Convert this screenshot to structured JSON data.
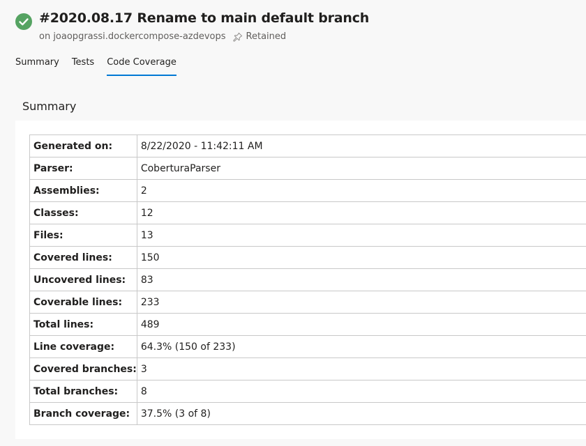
{
  "header": {
    "title": "#2020.08.17 Rename to main default branch",
    "subtitle": "on joaopgrassi.dockercompose-azdevops",
    "retained_label": "Retained",
    "status_icon": "check-circle-icon",
    "status_color": "#55a362"
  },
  "tabs": [
    {
      "label": "Summary"
    },
    {
      "label": "Tests"
    },
    {
      "label": "Code Coverage",
      "active": true
    }
  ],
  "accent_color": "#0078d4",
  "summary": {
    "section_title": "Summary",
    "rows": [
      {
        "key": "Generated on:",
        "value": "8/22/2020 - 11:42:11 AM"
      },
      {
        "key": "Parser:",
        "value": "CoberturaParser"
      },
      {
        "key": "Assemblies:",
        "value": "2"
      },
      {
        "key": "Classes:",
        "value": "12"
      },
      {
        "key": "Files:",
        "value": "13"
      },
      {
        "key": "Covered lines:",
        "value": "150"
      },
      {
        "key": "Uncovered lines:",
        "value": "83"
      },
      {
        "key": "Coverable lines:",
        "value": "233"
      },
      {
        "key": "Total lines:",
        "value": "489"
      },
      {
        "key": "Line coverage:",
        "value": "64.3% (150 of 233)"
      },
      {
        "key": "Covered branches:",
        "value": "3"
      },
      {
        "key": "Total branches:",
        "value": "8"
      },
      {
        "key": "Branch coverage:",
        "value": "37.5% (3 of 8)"
      }
    ]
  }
}
